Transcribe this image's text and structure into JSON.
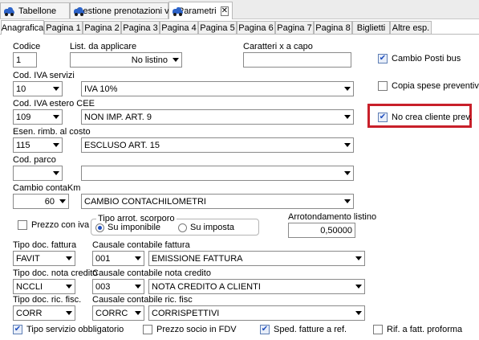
{
  "doc_tabs": [
    {
      "label": "Tabellone"
    },
    {
      "label": "Gestione prenotazioni varia"
    },
    {
      "label": "Parametri"
    }
  ],
  "close_glyph": "✕",
  "page_tabs": [
    "Anagrafica",
    "Pagina 1",
    "Pagina 2",
    "Pagina 3",
    "Pagina 4",
    "Pagina 5",
    "Pagina 6",
    "Pagina 7",
    "Pagina 8",
    "Biglietti",
    "Altre esp."
  ],
  "form": {
    "codice": {
      "label": "Codice",
      "value": "1"
    },
    "listino": {
      "label": "List. da applicare",
      "value": "No listino"
    },
    "caratteri": {
      "label": "Caratteri x a capo",
      "value": ""
    },
    "cod_iva_servizi": {
      "label": "Cod. IVA servizi",
      "code": "10",
      "desc": "IVA 10%"
    },
    "cod_iva_estero": {
      "label": "Cod. IVA estero CEE",
      "code": "109",
      "desc": "NON IMP. ART. 9"
    },
    "esen_rimb": {
      "label": "Esen. rimb. al costo",
      "code": "115",
      "desc": "ESCLUSO ART. 15"
    },
    "cod_parco": {
      "label": "Cod. parco",
      "code": "",
      "desc": ""
    },
    "cambio_km": {
      "label": "Cambio contaKm",
      "code": "60",
      "desc": "CAMBIO CONTACHILOMETRI"
    },
    "prezzo_con_iva": {
      "label": "Prezzo con iva",
      "checked": false
    },
    "tipo_arrot": {
      "label": "Tipo arrot. scorporo",
      "options": [
        "Su imponibile",
        "Su imposta"
      ],
      "selected": 0
    },
    "arrot_listino": {
      "label": "Arrotondamento listino",
      "value": "0,50000"
    },
    "tipo_doc_fattura": {
      "label": "Tipo doc. fattura",
      "value": "FAVIT"
    },
    "causale_fattura": {
      "label": "Causale contabile fattura",
      "code": "001",
      "desc": "EMISSIONE FATTURA"
    },
    "tipo_doc_nota": {
      "label": "Tipo doc. nota credito",
      "value": "NCCLI"
    },
    "causale_nota": {
      "label": "Causale contabile nota credito",
      "code": "003",
      "desc": "NOTA CREDITO A CLIENTI"
    },
    "tipo_doc_ric": {
      "label": "Tipo doc. ric. fisc.",
      "value": "CORR"
    },
    "causale_ric": {
      "label": "Causale contabile ric. fisc",
      "code": "CORRC",
      "desc": "CORRISPETTIVI"
    }
  },
  "right_checks": [
    {
      "label": "Cambio Posti bus",
      "checked": true
    },
    {
      "label": "Copia spese preventivi",
      "checked": false
    },
    {
      "label": "No crea cliente prev.",
      "checked": true
    }
  ],
  "bottom_checks": [
    {
      "label": "Tipo servizio obbligatorio",
      "checked": true
    },
    {
      "label": "Prezzo socio in FDV",
      "checked": false
    },
    {
      "label": "Sped. fatture a ref.",
      "checked": true
    },
    {
      "label": "Rif. a fatt. proforma",
      "checked": false
    }
  ],
  "check_glyph": "✔",
  "colors": {
    "highlight": "#c8202a",
    "accent": "#2d63c8"
  }
}
